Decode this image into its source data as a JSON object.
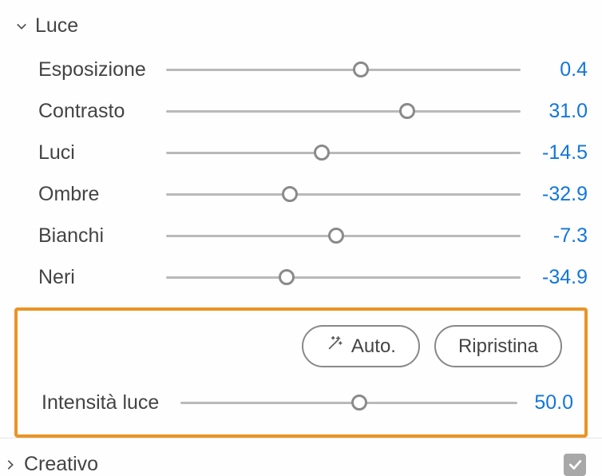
{
  "light": {
    "title": "Luce",
    "sliders": [
      {
        "label": "Esposizione",
        "value": "0.4",
        "pos": 55
      },
      {
        "label": "Contrasto",
        "value": "31.0",
        "pos": 68
      },
      {
        "label": "Luci",
        "value": "-14.5",
        "pos": 44
      },
      {
        "label": "Ombre",
        "value": "-32.9",
        "pos": 35
      },
      {
        "label": "Bianchi",
        "value": "-7.3",
        "pos": 48
      },
      {
        "label": "Neri",
        "value": "-34.9",
        "pos": 34
      }
    ],
    "auto_label": "Auto.",
    "reset_label": "Ripristina",
    "intensity": {
      "label": "Intensità luce",
      "value": "50.0",
      "pos": 53
    }
  },
  "creative": {
    "title": "Creativo",
    "enabled": true
  }
}
